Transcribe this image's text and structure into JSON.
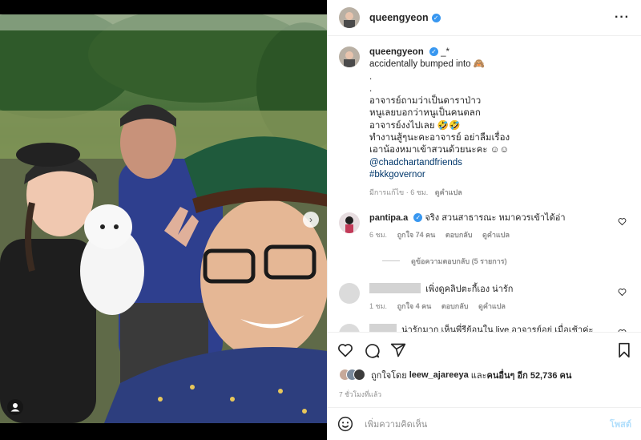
{
  "header": {
    "username": "queengyeon",
    "more_icon": "more-horizontal-icon"
  },
  "caption": {
    "username": "queengyeon",
    "suffix": "_*",
    "lines": [
      "accidentally bumped into 🙈",
      ".",
      ".",
      "อาจารย์ถามว่าเป็นดาราป่าว",
      "หนูเลยบอกว่าหนูเป็นคนตลก",
      "อาจารย์งงไปเลย 🤣🤣",
      "ทำงานสู้ๆนะคะอาจารย์ อย่าลืมเรื่อง",
      "เอาน้องหมาเข้าสวนด้วยนะคะ ☺☺"
    ],
    "mention": "@chadchartandfriends",
    "hashtag": "#bkkgovernor",
    "edited": "มีการแก้ไข · 6 ชม.",
    "translate": "ดูคำแปล"
  },
  "comments": [
    {
      "username": "pantipa.a",
      "text": "จริง สวนสาธารณะ หมาควรเข้าได้อ่า",
      "time": "6 ชม.",
      "likes": "ถูกใจ 74 คน",
      "reply": "ตอบกลับ",
      "translate": "ดูคำแปล",
      "view_replies": "ดูข้อความตอบกลับ (5 รายการ)"
    },
    {
      "text": "เพิ่งดูคลิปตะกี้เอง น่ารัก",
      "time": "1 ชม.",
      "likes": "ถูกใจ 4 คน",
      "reply": "ตอบกลับ",
      "translate": "ดูคำแปล"
    },
    {
      "text": "น่ารักมาก เห็นพี่รีย้อนใน live อาจารย์อยู่ เมื่อเช้าค่ะ"
    }
  ],
  "likes": {
    "prefix": "ถูกใจโดย",
    "user": "leew_ajareeya",
    "middle": "และ",
    "others": "คนอื่นๆ อีก 52,736 คน"
  },
  "time_ago": "7 ชั่วโมงที่แล้ว",
  "add_comment": {
    "placeholder": "เพิ่มความคิดเห็น",
    "post_label": "โพสต์"
  },
  "colors": {
    "accent": "#3897f0",
    "link": "#00376b",
    "muted": "#8e8e8e",
    "post_button_disabled": "#b2dffc"
  }
}
